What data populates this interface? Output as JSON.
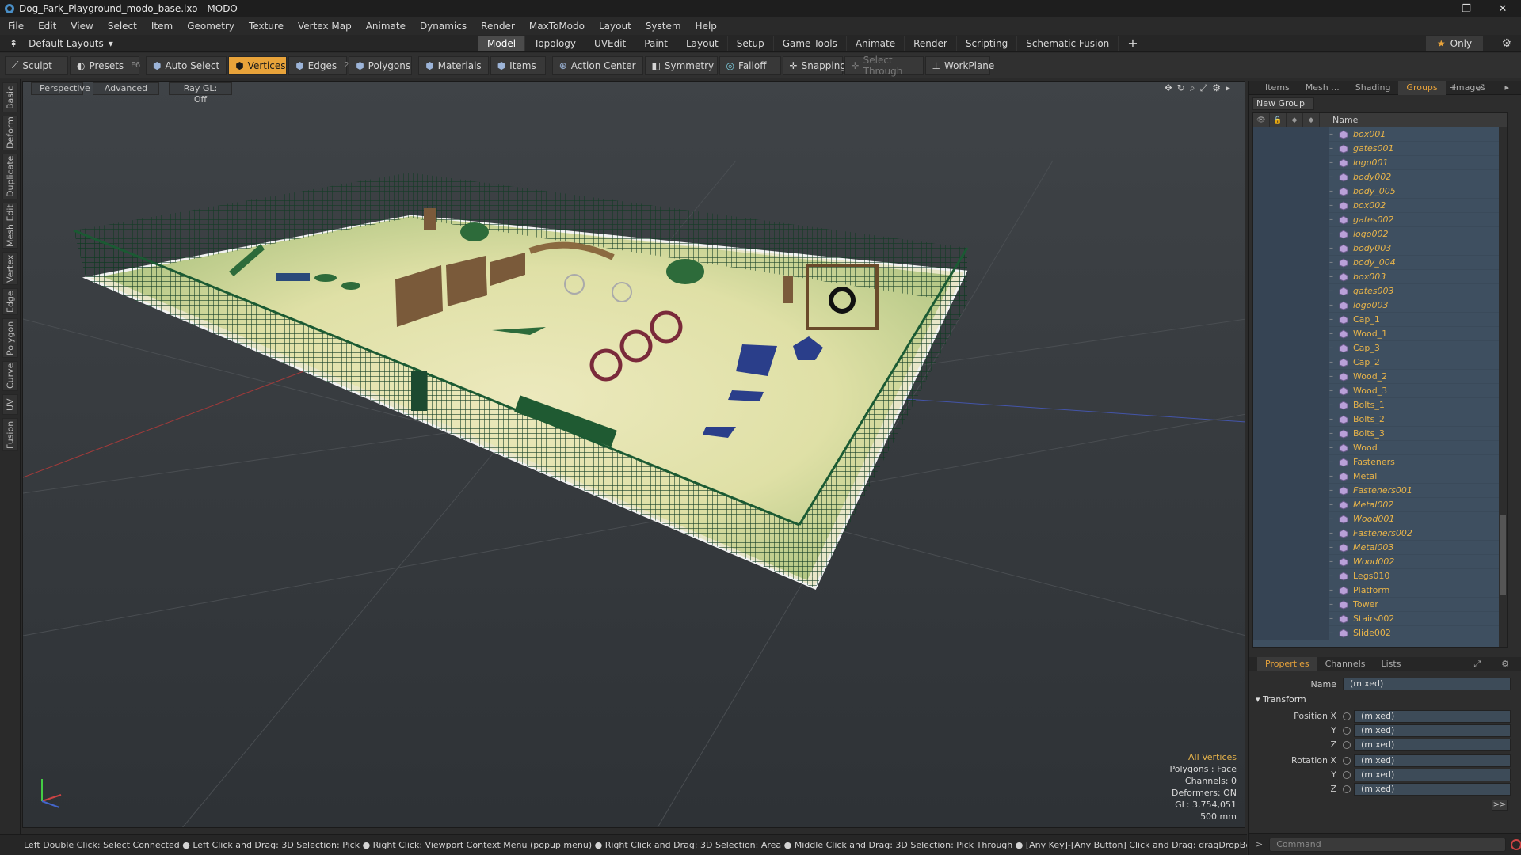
{
  "window": {
    "title": "Dog_Park_Playground_modo_base.lxo - MODO"
  },
  "menu": [
    "File",
    "Edit",
    "View",
    "Select",
    "Item",
    "Geometry",
    "Texture",
    "Vertex Map",
    "Animate",
    "Dynamics",
    "Render",
    "MaxToModo",
    "Layout",
    "System",
    "Help"
  ],
  "layoutbar": {
    "layout_name": "Default Layouts",
    "tabs": [
      "Model",
      "Topology",
      "UVEdit",
      "Paint",
      "Layout",
      "Setup",
      "Game Tools",
      "Animate",
      "Render",
      "Scripting",
      "Schematic Fusion"
    ],
    "active_tab": "Model",
    "only_label": "Only"
  },
  "toolbar": {
    "sculpt": "Sculpt",
    "presets": "Presets",
    "presets_key": "F6",
    "auto_select": "Auto Select",
    "vertices": "Vertices",
    "edges": "Edges",
    "edges_count": "2",
    "polygons": "Polygons",
    "materials": "Materials",
    "items": "Items",
    "action_center": "Action Center",
    "symmetry": "Symmetry",
    "falloff": "Falloff",
    "snapping": "Snapping",
    "select_through": "Select Through",
    "workplane": "WorkPlane"
  },
  "lefttabs": [
    "Basic",
    "Deform",
    "Duplicate",
    "Mesh Edit",
    "Vertex",
    "Edge",
    "Polygon",
    "Curve",
    "UV",
    "Fusion"
  ],
  "viewport": {
    "view": "Perspective",
    "mode": "Advanced",
    "raygl": "Ray GL: Off",
    "info": {
      "selection": "All Vertices",
      "polygons": "Polygons : Face",
      "channels": "Channels: 0",
      "deformers": "Deformers: ON",
      "gl": "GL: 3,754,051",
      "scale": "500 mm"
    }
  },
  "statusbar": "Left Double Click: Select Connected ● Left Click and Drag: 3D Selection: Pick ● Right Click: Viewport Context Menu (popup menu) ● Right Click and Drag: 3D Selection: Area ● Middle Click and Drag: 3D Selection: Pick Through ● [Any Key]-[Any Button] Click and Drag: dragDropBegin",
  "panel_tabs": [
    "Items",
    "Mesh ...",
    "Shading",
    "Groups",
    "Images"
  ],
  "panel_active": "Groups",
  "groups": {
    "new_group": "New Group",
    "name_header": "Name",
    "items": [
      {
        "name": "box001",
        "italic": true
      },
      {
        "name": "gates001",
        "italic": true
      },
      {
        "name": "logo001",
        "italic": true
      },
      {
        "name": "body002",
        "italic": true
      },
      {
        "name": "body_005",
        "italic": true
      },
      {
        "name": "box002",
        "italic": true
      },
      {
        "name": "gates002",
        "italic": true
      },
      {
        "name": "logo002",
        "italic": true
      },
      {
        "name": "body003",
        "italic": true
      },
      {
        "name": "body_004",
        "italic": true
      },
      {
        "name": "box003",
        "italic": true
      },
      {
        "name": "gates003",
        "italic": true
      },
      {
        "name": "logo003",
        "italic": true
      },
      {
        "name": "Cap_1",
        "italic": false
      },
      {
        "name": "Wood_1",
        "italic": false
      },
      {
        "name": "Cap_3",
        "italic": false
      },
      {
        "name": "Cap_2",
        "italic": false
      },
      {
        "name": "Wood_2",
        "italic": false
      },
      {
        "name": "Wood_3",
        "italic": false
      },
      {
        "name": "Bolts_1",
        "italic": false
      },
      {
        "name": "Bolts_2",
        "italic": false
      },
      {
        "name": "Bolts_3",
        "italic": false
      },
      {
        "name": "Wood",
        "italic": false
      },
      {
        "name": "Fasteners",
        "italic": false
      },
      {
        "name": "Metal",
        "italic": false
      },
      {
        "name": "Fasteners001",
        "italic": true
      },
      {
        "name": "Metal002",
        "italic": true
      },
      {
        "name": "Wood001",
        "italic": true
      },
      {
        "name": "Fasteners002",
        "italic": true
      },
      {
        "name": "Metal003",
        "italic": true
      },
      {
        "name": "Wood002",
        "italic": true
      },
      {
        "name": "Legs010",
        "italic": false
      },
      {
        "name": "Platform",
        "italic": false
      },
      {
        "name": "Tower",
        "italic": false
      },
      {
        "name": "Stairs002",
        "italic": false
      },
      {
        "name": "Slide002",
        "italic": false
      }
    ]
  },
  "props_tabs": [
    "Properties",
    "Channels",
    "Lists"
  ],
  "properties": {
    "name_label": "Name",
    "name_value": "(mixed)",
    "section": "Transform",
    "position": [
      {
        "label": "Position X",
        "value": "(mixed)"
      },
      {
        "label": "Y",
        "value": "(mixed)"
      },
      {
        "label": "Z",
        "value": "(mixed)"
      }
    ],
    "rotation": [
      {
        "label": "Rotation X",
        "value": "(mixed)"
      },
      {
        "label": "Y",
        "value": "(mixed)"
      },
      {
        "label": "Z",
        "value": "(mixed)"
      }
    ],
    "expand": ">>"
  },
  "command": {
    "placeholder": "Command"
  },
  "colors": {
    "accent": "#e8a33a",
    "tree_bg": "#3e4f60",
    "item_text": "#e8b44a"
  }
}
